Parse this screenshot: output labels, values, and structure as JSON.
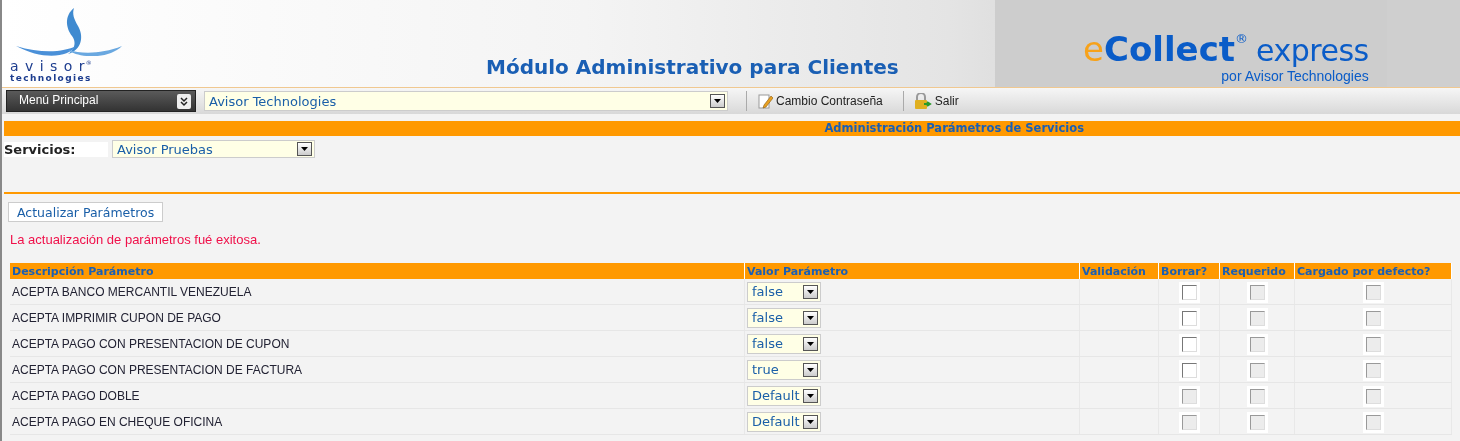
{
  "header": {
    "avisor_logo": {
      "name": "a v i s o r",
      "registered": "®",
      "subtitle": "technologies"
    },
    "title": "Módulo Administrativo para Clientes",
    "ecollect_logo": {
      "prefix": "e",
      "main": "Collect",
      "registered": "®",
      "suffix": "express",
      "tagline": "por Avisor Technologies"
    }
  },
  "toolbar": {
    "menu": "Menú Principal",
    "client_select": "Avisor Technologies",
    "actions": [
      {
        "label": "Cambio Contraseña",
        "kind": "password"
      },
      {
        "label": "Salir",
        "kind": "exit"
      }
    ]
  },
  "section_title": "Administración Parámetros de Servicios",
  "services": {
    "label": "Servicios:",
    "value": "Avisor Pruebas"
  },
  "update_button": "Actualizar Parámetros",
  "message": "La actualización de parámetros fué exitosa.",
  "table": {
    "columns": [
      "Descripción Parámetro",
      "Valor Parámetro",
      "Validación",
      "Borrar?",
      "Requerido",
      "Cargado por defecto?"
    ],
    "rows": [
      {
        "description": "ACEPTA BANCO MERCANTIL VENEZUELA",
        "value": "false",
        "borrar": {
          "checked": false,
          "disabled": false
        },
        "requerido": {
          "checked": false,
          "disabled": true
        },
        "cargado": {
          "checked": false,
          "disabled": true
        }
      },
      {
        "description": "ACEPTA IMPRIMIR CUPON DE PAGO",
        "value": "false",
        "borrar": {
          "checked": false,
          "disabled": false
        },
        "requerido": {
          "checked": false,
          "disabled": true
        },
        "cargado": {
          "checked": false,
          "disabled": true
        }
      },
      {
        "description": "ACEPTA PAGO CON PRESENTACION DE CUPON",
        "value": "false",
        "borrar": {
          "checked": false,
          "disabled": false
        },
        "requerido": {
          "checked": false,
          "disabled": true
        },
        "cargado": {
          "checked": false,
          "disabled": true
        }
      },
      {
        "description": "ACEPTA PAGO CON PRESENTACION DE FACTURA",
        "value": "true",
        "borrar": {
          "checked": false,
          "disabled": false
        },
        "requerido": {
          "checked": false,
          "disabled": true
        },
        "cargado": {
          "checked": false,
          "disabled": true
        }
      },
      {
        "description": "ACEPTA PAGO DOBLE",
        "value": "Default",
        "borrar": {
          "checked": false,
          "disabled": true
        },
        "requerido": {
          "checked": false,
          "disabled": true
        },
        "cargado": {
          "checked": false,
          "disabled": true
        }
      },
      {
        "description": "ACEPTA PAGO EN CHEQUE OFICINA",
        "value": "Default",
        "borrar": {
          "checked": false,
          "disabled": true
        },
        "requerido": {
          "checked": false,
          "disabled": true
        },
        "cargado": {
          "checked": false,
          "disabled": true
        }
      }
    ]
  }
}
